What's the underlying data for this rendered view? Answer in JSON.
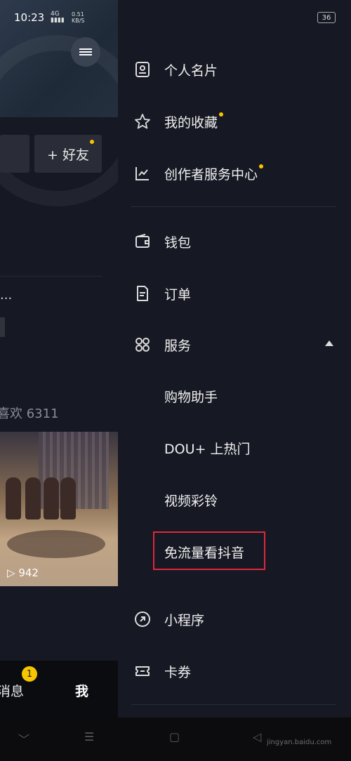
{
  "status_bar": {
    "time": "10:23",
    "network": "4G",
    "speed": "0.51",
    "speed_unit": "KB/S",
    "battery": "36"
  },
  "profile": {
    "add_friend": "+ 好友",
    "ellipsis": "...",
    "likes": "喜欢 6311",
    "video_views": "942"
  },
  "tab_bar": {
    "messages": "消息",
    "messages_badge": "1",
    "me": "我"
  },
  "drawer": {
    "items": [
      {
        "label": "个人名片",
        "icon": "id-card-icon"
      },
      {
        "label": "我的收藏",
        "icon": "star-icon",
        "dot": true
      },
      {
        "label": "创作者服务中心",
        "icon": "chart-icon",
        "dot": true
      },
      {
        "label": "钱包",
        "icon": "wallet-icon"
      },
      {
        "label": "订单",
        "icon": "document-icon"
      },
      {
        "label": "服务",
        "icon": "grid-icon",
        "expanded": true
      },
      {
        "label": "小程序",
        "icon": "link-icon"
      },
      {
        "label": "卡券",
        "icon": "ticket-icon"
      }
    ],
    "service_subitems": [
      "购物助手",
      "DOU+ 上热门",
      "视频彩铃",
      "免流量看抖音"
    ],
    "highlighted_subitem": "免流量看抖音"
  },
  "watermark": "jingyan.baidu.com",
  "colors": {
    "background": "#161823",
    "accent_dot": "#f7c600",
    "highlight_border": "#e0283a"
  }
}
